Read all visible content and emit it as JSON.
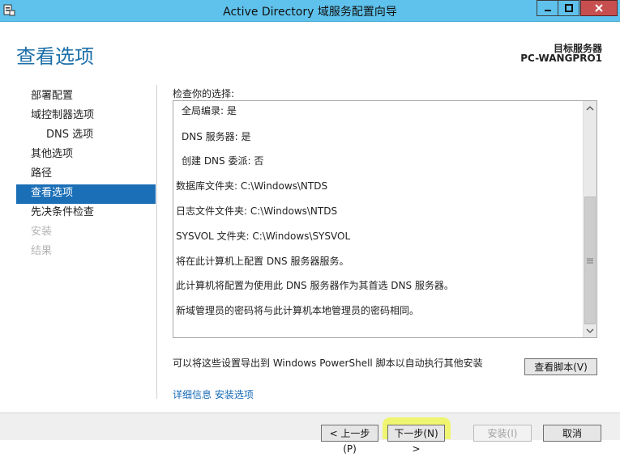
{
  "window": {
    "title": "Active Directory 域服务配置向导",
    "minimize_glyph": "—",
    "maximize_glyph": "□",
    "close_glyph": "✕"
  },
  "header": {
    "page_title": "查看选项",
    "target_label": "目标服务器",
    "target_name": "PC-WANGPRO1"
  },
  "sidebar": {
    "items": [
      {
        "label": "部署配置"
      },
      {
        "label": "域控制器选项"
      },
      {
        "label": "DNS 选项"
      },
      {
        "label": "其他选项"
      },
      {
        "label": "路径"
      },
      {
        "label": "查看选项"
      },
      {
        "label": "先决条件检查"
      },
      {
        "label": "安装"
      },
      {
        "label": "结果"
      }
    ]
  },
  "review": {
    "label": "检查你的选择:",
    "lines": [
      "全局编录: 是",
      "DNS 服务器: 是",
      "创建 DNS 委派: 否",
      "数据库文件夹: C:\\Windows\\NTDS",
      "日志文件文件夹: C:\\Windows\\NTDS",
      "SYSVOL 文件夹: C:\\Windows\\SYSVOL",
      "将在此计算机上配置 DNS 服务器服务。",
      "此计算机将配置为使用此 DNS 服务器作为其首选 DNS 服务器。",
      "新域管理员的密码将与此计算机本地管理员的密码相同。"
    ]
  },
  "export": {
    "text": "可以将这些设置导出到 Windows PowerShell 脚本以自动执行其他安装",
    "view_script_label": "查看脚本(V)"
  },
  "links": {
    "details": "详细信息",
    "install_options": "安装选项"
  },
  "footer": {
    "prev_label": "< 上一步(P)",
    "next_label": "下一步(N) >",
    "install_label": "安装(I)",
    "cancel_label": "取消"
  }
}
